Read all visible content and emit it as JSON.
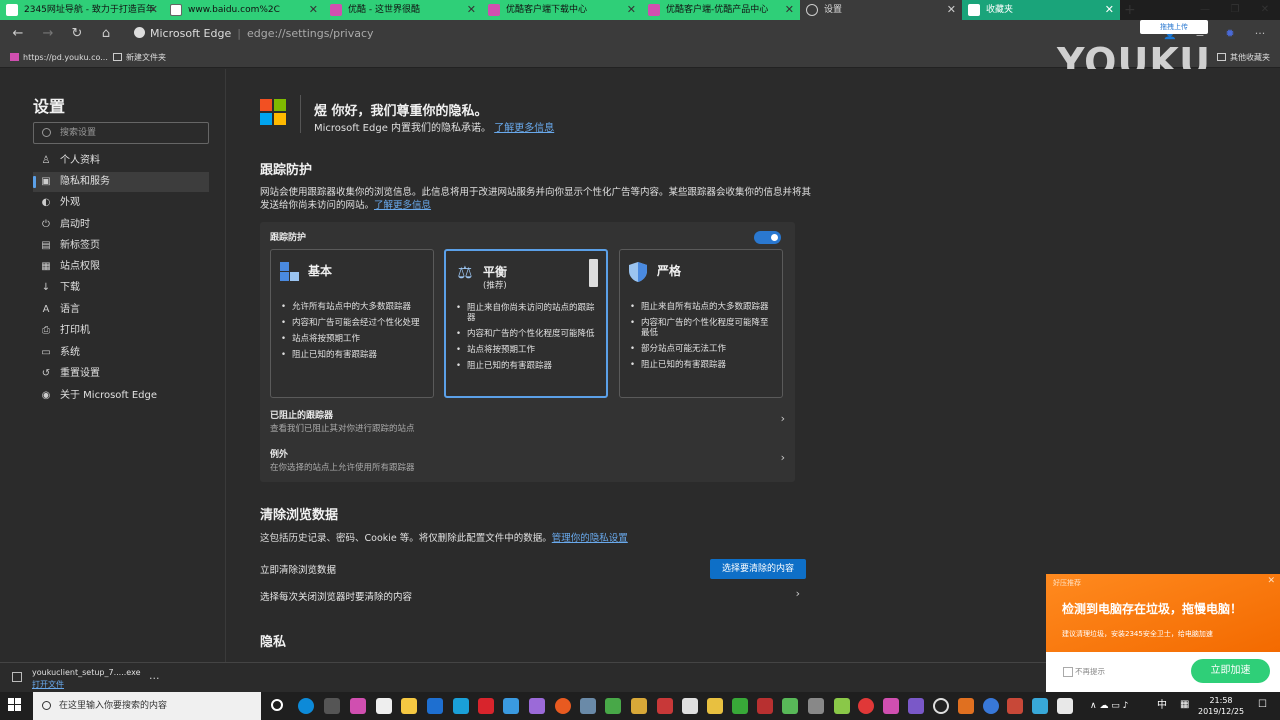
{
  "tabs": [
    {
      "label": "2345网址导航 - 致力于打造百年",
      "color": "#2fcf78",
      "style": "green"
    },
    {
      "label": "www.baidu.com%2C",
      "color": "#2fcf78",
      "style": "green"
    },
    {
      "label": "优酷 - 这世界很酷",
      "color": "#2fcf78",
      "style": "green"
    },
    {
      "label": "优酷客户端下载中心",
      "color": "#2fcf78",
      "style": "green"
    },
    {
      "label": "优酷客户端-优酷产品中心",
      "color": "#2fcf78",
      "style": "green"
    },
    {
      "label": "设置",
      "color": "#3b3b3b",
      "style": "dark"
    },
    {
      "label": "收藏夹",
      "color": "#1aa47a",
      "style": "teal"
    }
  ],
  "address": {
    "site_name": "Microsoft Edge",
    "url": "edge://settings/privacy"
  },
  "bookmarks": [
    {
      "label": "https://pd.youku.co..."
    },
    {
      "label": "新建文件夹"
    },
    {
      "label": "其他收藏夹"
    }
  ],
  "watermark": {
    "brand": "YOUKU",
    "upload_label": "拖拽上传"
  },
  "sidebar": {
    "title": "设置",
    "search_placeholder": "搜索设置",
    "items": [
      {
        "label": "个人资料",
        "icon": "person-icon"
      },
      {
        "label": "隐私和服务",
        "icon": "lock-icon",
        "active": true
      },
      {
        "label": "外观",
        "icon": "palette-icon"
      },
      {
        "label": "启动时",
        "icon": "power-icon"
      },
      {
        "label": "新标签页",
        "icon": "newtab-icon"
      },
      {
        "label": "站点权限",
        "icon": "permissions-icon"
      },
      {
        "label": "下载",
        "icon": "download-icon"
      },
      {
        "label": "语言",
        "icon": "language-icon"
      },
      {
        "label": "打印机",
        "icon": "printer-icon"
      },
      {
        "label": "系统",
        "icon": "system-icon"
      },
      {
        "label": "重置设置",
        "icon": "reset-icon"
      },
      {
        "label": "关于 Microsoft Edge",
        "icon": "edge-icon"
      }
    ]
  },
  "main": {
    "greeting": "煜 你好，我们尊重你的隐私。",
    "greeting_sub": "Microsoft Edge 内置我们的隐私承诺。",
    "greeting_link": "了解更多信息",
    "tracking": {
      "heading": "跟踪防护",
      "description": "网站会使用跟踪器收集你的浏览信息。此信息将用于改进网站服务并向你显示个性化广告等内容。某些跟踪器会收集你的信息并将其发送给你尚未访问的网站。",
      "description_link": "了解更多信息",
      "panel_label": "跟踪防护",
      "enabled": true,
      "cards": [
        {
          "title": "基本",
          "subtitle": "",
          "selected": false,
          "bullets": [
            "允许所有站点中的大多数跟踪器",
            "内容和广告可能会经过个性化处理",
            "站点将按预期工作",
            "阻止已知的有害跟踪器"
          ]
        },
        {
          "title": "平衡",
          "subtitle": "(推荐)",
          "selected": true,
          "bullets": [
            "阻止来自你尚未访问的站点的跟踪器",
            "内容和广告的个性化程度可能降低",
            "站点将按预期工作",
            "阻止已知的有害跟踪器"
          ]
        },
        {
          "title": "严格",
          "subtitle": "",
          "selected": false,
          "bullets": [
            "阻止来自所有站点的大多数跟踪器",
            "内容和广告的个性化程度可能降至最低",
            "部分站点可能无法工作",
            "阻止已知的有害跟踪器"
          ]
        }
      ],
      "blocked_title": "已阻止的跟踪器",
      "blocked_sub": "查看我们已阻止其对你进行跟踪的站点",
      "exceptions_title": "例外",
      "exceptions_sub": "在你选择的站点上允许使用所有跟踪器"
    },
    "clear": {
      "heading": "清除浏览数据",
      "description": "这包括历史记录、密码、Cookie 等。将仅删除此配置文件中的数据。",
      "description_link": "管理你的隐私设置",
      "clear_now": "立即清除浏览数据",
      "clear_button": "选择要清除的内容",
      "on_close": "选择每次关闭浏览器时要清除的内容"
    },
    "privacy_heading": "隐私"
  },
  "download": {
    "file": "youkuclient_setup_7.....exe",
    "open": "打开文件",
    "more": "···"
  },
  "ad": {
    "brand": "好压推荐",
    "title": "检测到电脑存在垃圾，拖慢电脑！",
    "subtitle": "建议清理垃圾，安装2345安全卫士，给电脑加速",
    "checkbox": "不再提示",
    "button": "立即加速"
  },
  "taskbar": {
    "search_placeholder": "在这里输入你要搜索的内容",
    "ime": "中",
    "time": "21:58",
    "date": "2019/12/25"
  },
  "colors": {
    "accent": "#5ba0e8",
    "primary_button": "#0e6fc7",
    "tab_green": "#2fcf78",
    "ad_orange": "#f36a00"
  }
}
